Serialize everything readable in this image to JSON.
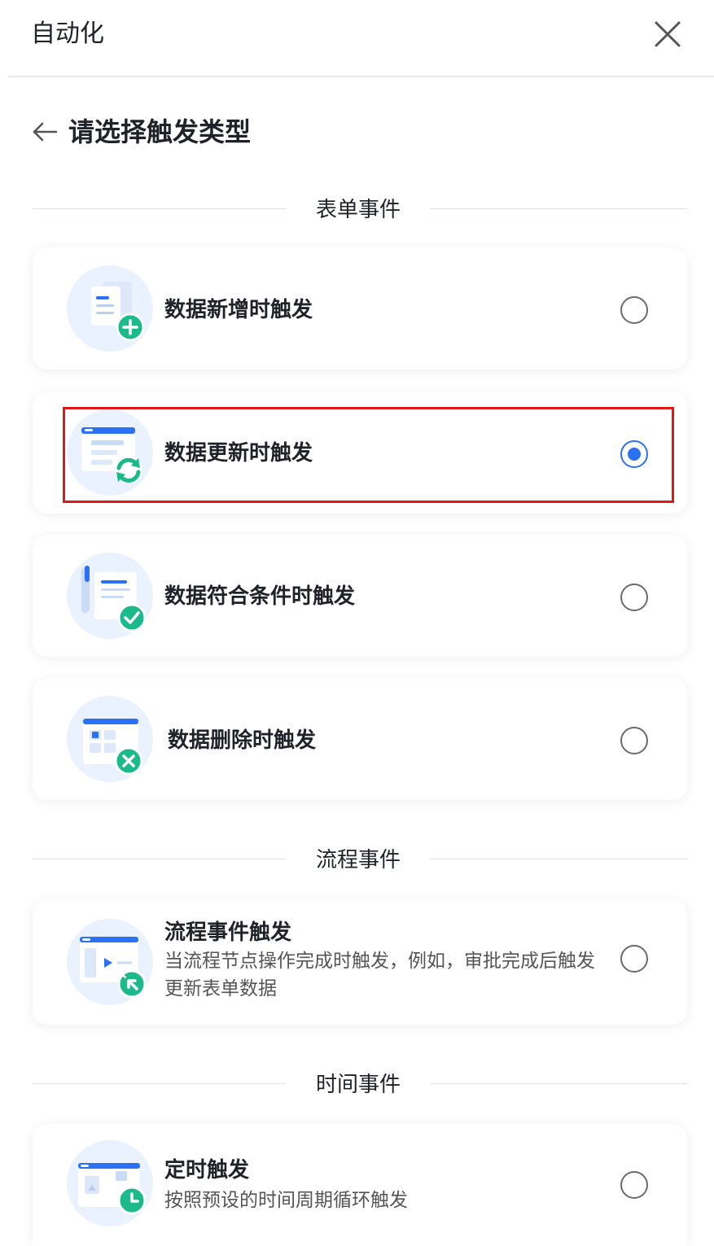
{
  "header": {
    "title": "自动化"
  },
  "page": {
    "title": "请选择触发类型"
  },
  "sections": {
    "form_events": "表单事件",
    "flow_events": "流程事件",
    "time_events": "时间事件"
  },
  "options": {
    "data_added": {
      "name": "数据新增时触发",
      "selected": false
    },
    "data_updated": {
      "name": "数据更新时触发",
      "selected": true
    },
    "data_condition": {
      "name": "数据符合条件时触发",
      "selected": false
    },
    "data_deleted": {
      "name": "数据删除时触发",
      "selected": false
    },
    "flow_event": {
      "name": "流程事件触发",
      "desc_line1": "当流程节点操作完成时触发，例如，审批完成后触发",
      "desc_line2": "更新表单数据",
      "selected": false
    },
    "scheduled": {
      "name": "定时触发",
      "desc": "按照预设的时间周期循环触发",
      "selected": false
    }
  },
  "colors": {
    "accent_blue": "#2a71f6",
    "badge_green": "#1bb98c",
    "icon_bg": "#eaf2ff",
    "highlight_red": "#e01717"
  }
}
